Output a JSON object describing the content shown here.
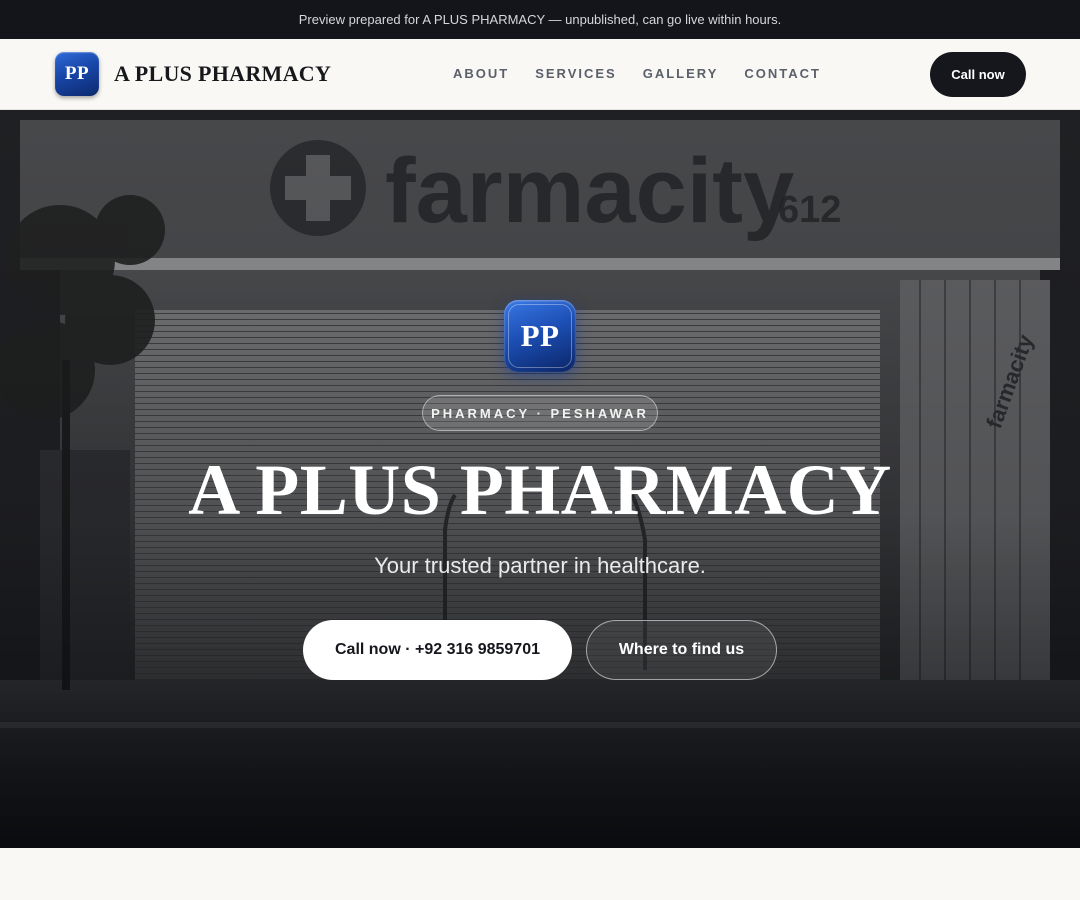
{
  "topbar": {
    "notice": "Preview prepared for A PLUS PHARMACY — unpublished, can go live within hours."
  },
  "header": {
    "logo_initials": "PP",
    "brand_name": "A PLUS PHARMACY",
    "nav": [
      "ABOUT",
      "SERVICES",
      "GALLERY",
      "CONTACT"
    ],
    "call_label": "Call now"
  },
  "hero": {
    "badge_initials": "PP",
    "tag": "PHARMACY · PESHAWAR",
    "title": "A PLUS PHARMACY",
    "subtitle": "Your trusted partner in healthcare.",
    "primary_button": "Call now · +92 316 9859701",
    "secondary_button": "Where to find us",
    "photo": {
      "storefront_sign": "farmacity",
      "storefront_sign_number": "612",
      "side_sign": "farmacity"
    }
  },
  "colors": {
    "topbar_bg": "#13151b",
    "header_bg": "#f9f8f5",
    "brand_blue": "#1c4fb4",
    "dark_button": "#15171c"
  }
}
